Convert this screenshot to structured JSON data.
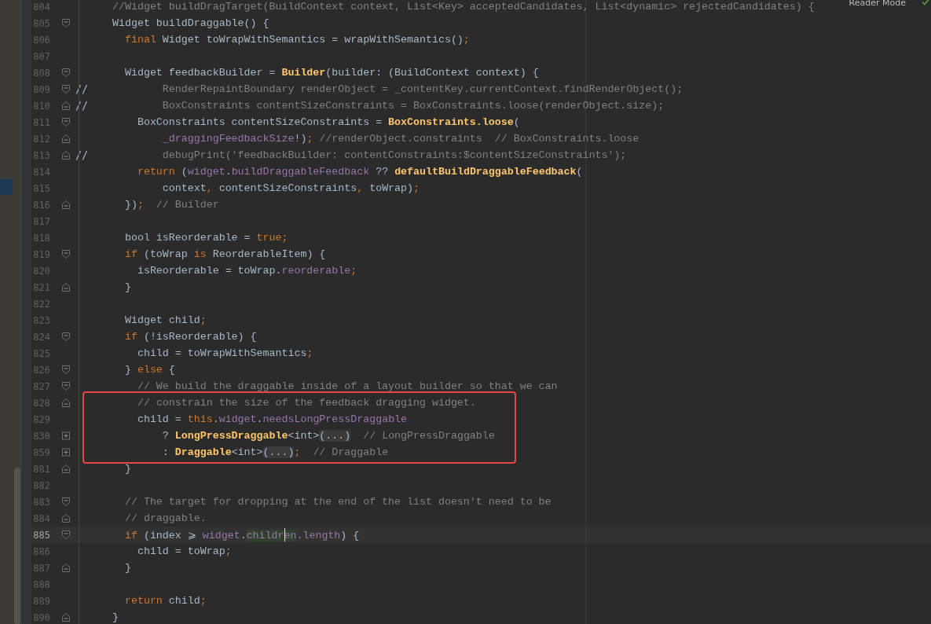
{
  "toolbar": {
    "reader_mode": "Reader Mode"
  },
  "lines": [
    {
      "number": "804",
      "tokens": [
        {
          "text": "//Widget buildDragTarget(BuildContext context, List<Key> acceptedCandidates, List<dynamic> rejectedCandidates) {",
          "kind": "comment"
        }
      ]
    },
    {
      "number": "805",
      "fold_open": true,
      "tokens": [
        {
          "text": "Widget buildDraggable() {",
          "kind": "plain"
        }
      ]
    },
    {
      "number": "806",
      "tokens": [
        {
          "text": "  final",
          "kind": "keyword"
        },
        {
          "text": " Widget toWrapWithSemantics = wrapWithSemantics()",
          "kind": "plain"
        },
        {
          "text": ";",
          "kind": "keyword"
        }
      ]
    },
    {
      "number": "807"
    },
    {
      "number": "808",
      "fold_open": true,
      "tokens": [
        {
          "text": "  Widget feedbackBuilder = ",
          "kind": "plain"
        },
        {
          "text": "Builder",
          "kind": "func"
        },
        {
          "text": "(builder: (BuildContext context) {",
          "kind": "plain"
        }
      ]
    },
    {
      "number": "809",
      "fold_open": true,
      "comment_mark": "//",
      "tokens": [
        {
          "text": "        RenderRepaintBoundary renderObject = _contentKey.currentContext.findRenderObject();",
          "kind": "comment"
        }
      ]
    },
    {
      "number": "810",
      "fold_close": true,
      "comment_mark": "//",
      "tokens": [
        {
          "text": "        BoxConstraints contentSizeConstraints = BoxConstraints.loose(renderObject.size);",
          "kind": "comment"
        }
      ]
    },
    {
      "number": "811",
      "fold_open": true,
      "tokens": [
        {
          "text": "    BoxConstraints contentSizeConstraints = ",
          "kind": "plain"
        },
        {
          "text": "BoxConstraints.loose",
          "kind": "func"
        },
        {
          "text": "(",
          "kind": "plain"
        }
      ]
    },
    {
      "number": "812",
      "fold_close": true,
      "tokens": [
        {
          "text": "        _draggingFeedbackSize",
          "kind": "field"
        },
        {
          "text": "!)",
          "kind": "plain"
        },
        {
          "text": ";",
          "kind": "keyword"
        },
        {
          "text": " //renderObject.constraints  // BoxConstraints.loose",
          "kind": "comment"
        }
      ]
    },
    {
      "number": "813",
      "fold_close": true,
      "comment_mark": "//",
      "tokens": [
        {
          "text": "        debugPrint('feedbackBuilder: contentConstraints:$contentSizeConstraints');",
          "kind": "comment"
        }
      ]
    },
    {
      "number": "814",
      "tokens": [
        {
          "text": "    return",
          "kind": "keyword"
        },
        {
          "text": " (",
          "kind": "plain"
        },
        {
          "text": "widget",
          "kind": "field"
        },
        {
          "text": ".",
          "kind": "plain"
        },
        {
          "text": "buildDraggableFeedback",
          "kind": "field"
        },
        {
          "text": " ?? ",
          "kind": "plain"
        },
        {
          "text": "defaultBuildDraggableFeedback",
          "kind": "func"
        },
        {
          "text": "(",
          "kind": "plain"
        }
      ]
    },
    {
      "number": "815",
      "tokens": [
        {
          "text": "        context",
          "kind": "plain"
        },
        {
          "text": ",",
          "kind": "keyword"
        },
        {
          "text": " contentSizeConstraints",
          "kind": "plain"
        },
        {
          "text": ",",
          "kind": "keyword"
        },
        {
          "text": " toWrap)",
          "kind": "plain"
        },
        {
          "text": ";",
          "kind": "keyword"
        }
      ]
    },
    {
      "number": "816",
      "fold_close": true,
      "tokens": [
        {
          "text": "  })",
          "kind": "plain"
        },
        {
          "text": ";",
          "kind": "keyword"
        },
        {
          "text": "  // Builder",
          "kind": "comment"
        }
      ]
    },
    {
      "number": "817"
    },
    {
      "number": "818",
      "tokens": [
        {
          "text": "  bool isReorderable = ",
          "kind": "plain"
        },
        {
          "text": "true;",
          "kind": "keyword"
        }
      ]
    },
    {
      "number": "819",
      "fold_open": true,
      "tokens": [
        {
          "text": "  if",
          "kind": "keyword"
        },
        {
          "text": " (toWrap ",
          "kind": "plain"
        },
        {
          "text": "is",
          "kind": "keyword"
        },
        {
          "text": " ReorderableItem) {",
          "kind": "plain"
        }
      ]
    },
    {
      "number": "820",
      "tokens": [
        {
          "text": "    isReorderable = toWrap.",
          "kind": "plain"
        },
        {
          "text": "reorderable",
          "kind": "field"
        },
        {
          "text": ";",
          "kind": "keyword"
        }
      ]
    },
    {
      "number": "821",
      "fold_close": true,
      "tokens": [
        {
          "text": "  }",
          "kind": "plain"
        }
      ]
    },
    {
      "number": "822"
    },
    {
      "number": "823",
      "tokens": [
        {
          "text": "  Widget child",
          "kind": "plain"
        },
        {
          "text": ";",
          "kind": "keyword"
        }
      ]
    },
    {
      "number": "824",
      "fold_open": true,
      "tokens": [
        {
          "text": "  if",
          "kind": "keyword"
        },
        {
          "text": " (!isReorderable) {",
          "kind": "plain"
        }
      ]
    },
    {
      "number": "825",
      "tokens": [
        {
          "text": "    child = toWrapWithSemantics",
          "kind": "plain"
        },
        {
          "text": ";",
          "kind": "keyword"
        }
      ]
    },
    {
      "number": "826",
      "fold_open": true,
      "tokens": [
        {
          "text": "  } ",
          "kind": "plain"
        },
        {
          "text": "else",
          "kind": "keyword"
        },
        {
          "text": " {",
          "kind": "plain"
        }
      ]
    },
    {
      "number": "827",
      "fold_open": true,
      "tokens": [
        {
          "text": "    // We build the draggable inside of a layout builder so that we can",
          "kind": "comment"
        }
      ]
    },
    {
      "number": "828",
      "fold_close": true,
      "boxed": true,
      "tokens": [
        {
          "text": "    // constrain the size of the feedback dragging widget.",
          "kind": "comment"
        }
      ]
    },
    {
      "number": "829",
      "boxed": true,
      "tokens": [
        {
          "text": "    child = ",
          "kind": "plain"
        },
        {
          "text": "this",
          "kind": "keyword"
        },
        {
          "text": ".",
          "kind": "plain"
        },
        {
          "text": "widget",
          "kind": "field"
        },
        {
          "text": ".",
          "kind": "plain"
        },
        {
          "text": "needsLongPressDraggable",
          "kind": "field"
        }
      ]
    },
    {
      "number": "830",
      "collapsed": true,
      "boxed": true,
      "tokens": [
        {
          "text": "        ? ",
          "kind": "plain"
        },
        {
          "text": "LongPressDraggable",
          "kind": "func"
        },
        {
          "text": "<int>",
          "kind": "plain"
        },
        {
          "text": "(...)",
          "kind": "folded"
        },
        {
          "text": "  // LongPressDraggable",
          "kind": "comment"
        }
      ]
    },
    {
      "number": "859",
      "collapsed": true,
      "boxed": true,
      "tokens": [
        {
          "text": "        : ",
          "kind": "plain"
        },
        {
          "text": "Draggable",
          "kind": "func"
        },
        {
          "text": "<int>",
          "kind": "plain"
        },
        {
          "text": "(...)",
          "kind": "folded"
        },
        {
          "text": ";",
          "kind": "keyword"
        },
        {
          "text": "  // Draggable",
          "kind": "comment"
        }
      ]
    },
    {
      "number": "881",
      "fold_close": true,
      "tokens": [
        {
          "text": "  }",
          "kind": "plain"
        }
      ]
    },
    {
      "number": "882"
    },
    {
      "number": "883",
      "fold_open": true,
      "tokens": [
        {
          "text": "  // The target for dropping at the end of the list doesn't need to be",
          "kind": "comment"
        }
      ]
    },
    {
      "number": "884",
      "fold_close": true,
      "tokens": [
        {
          "text": "  // draggable.",
          "kind": "comment"
        }
      ]
    },
    {
      "number": "885",
      "fold_open": true,
      "current": true,
      "tokens": [
        {
          "text": "  if",
          "kind": "keyword"
        },
        {
          "text": " (index ⩾ ",
          "kind": "plain"
        },
        {
          "text": "widget",
          "kind": "field"
        },
        {
          "text": ".",
          "kind": "plain"
        },
        {
          "text": "childr",
          "kind": "field",
          "highlight": true
        },
        {
          "text": "en",
          "kind": "field",
          "highlight": true,
          "caret_before": true
        },
        {
          "text": ".length",
          "kind": "field"
        },
        {
          "text": ") {",
          "kind": "plain"
        }
      ]
    },
    {
      "number": "886",
      "tokens": [
        {
          "text": "    child = toWrap",
          "kind": "plain"
        },
        {
          "text": ";",
          "kind": "keyword"
        }
      ]
    },
    {
      "number": "887",
      "fold_close": true,
      "tokens": [
        {
          "text": "  }",
          "kind": "plain"
        }
      ]
    },
    {
      "number": "888"
    },
    {
      "number": "889",
      "tokens": [
        {
          "text": "  return",
          "kind": "keyword"
        },
        {
          "text": " child",
          "kind": "plain"
        },
        {
          "text": ";",
          "kind": "keyword"
        }
      ]
    },
    {
      "number": "890",
      "fold_close": true,
      "tokens": [
        {
          "text": "}",
          "kind": "plain"
        }
      ]
    }
  ]
}
